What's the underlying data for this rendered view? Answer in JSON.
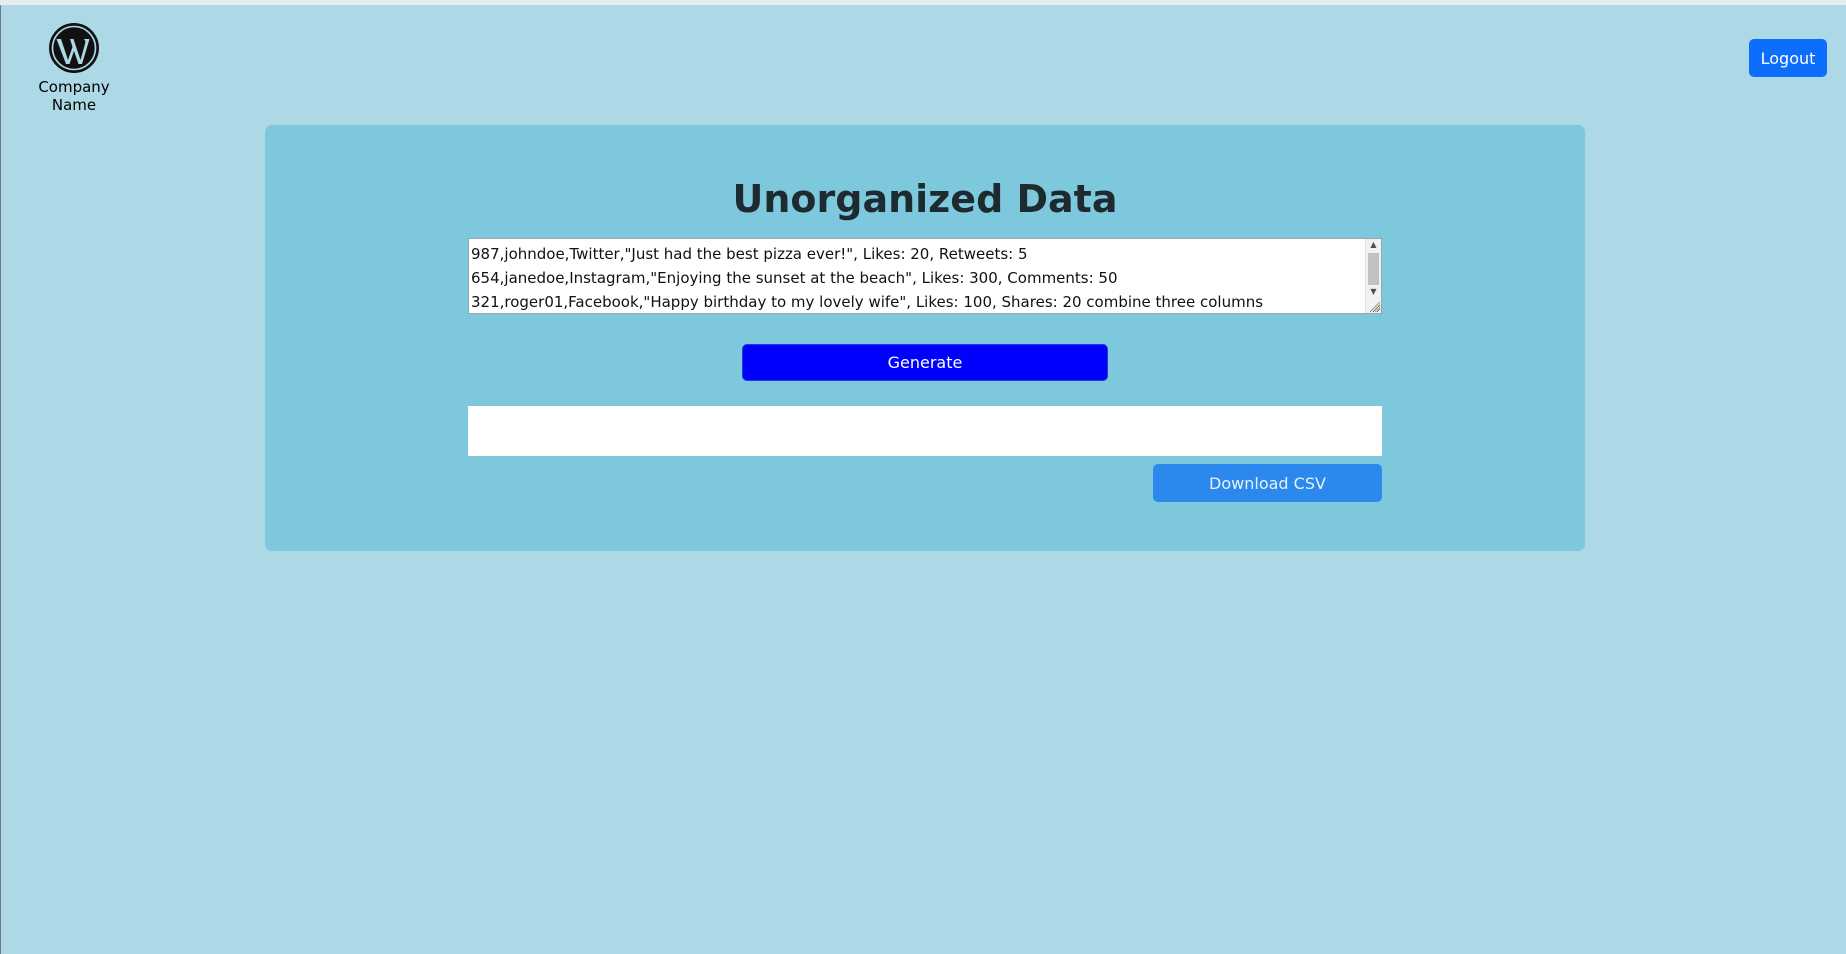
{
  "header": {
    "company_name": "Company Name",
    "logo_icon": "wordpress-logo-icon",
    "logout_label": "Logout"
  },
  "main": {
    "title": "Unorganized Data",
    "input_lines": [
      "987,johndoe,Twitter,\"Just had the best pizza ever!\", Likes: 20, Retweets: 5",
      "654,janedoe,Instagram,\"Enjoying the sunset at the beach\", Likes: 300, Comments: 50",
      "321,roger01,Facebook,\"Happy birthday to my lovely wife\", Likes: 100, Shares: 20 combine three columns"
    ],
    "generate_label": "Generate",
    "output_value": "",
    "download_label": "Download CSV"
  },
  "colors": {
    "page_background": "#add8e6",
    "panel_background": "#7ec8de",
    "logout_button": "#0d6efd",
    "generate_button": "#0000ff",
    "download_button": "#2b88ec"
  }
}
